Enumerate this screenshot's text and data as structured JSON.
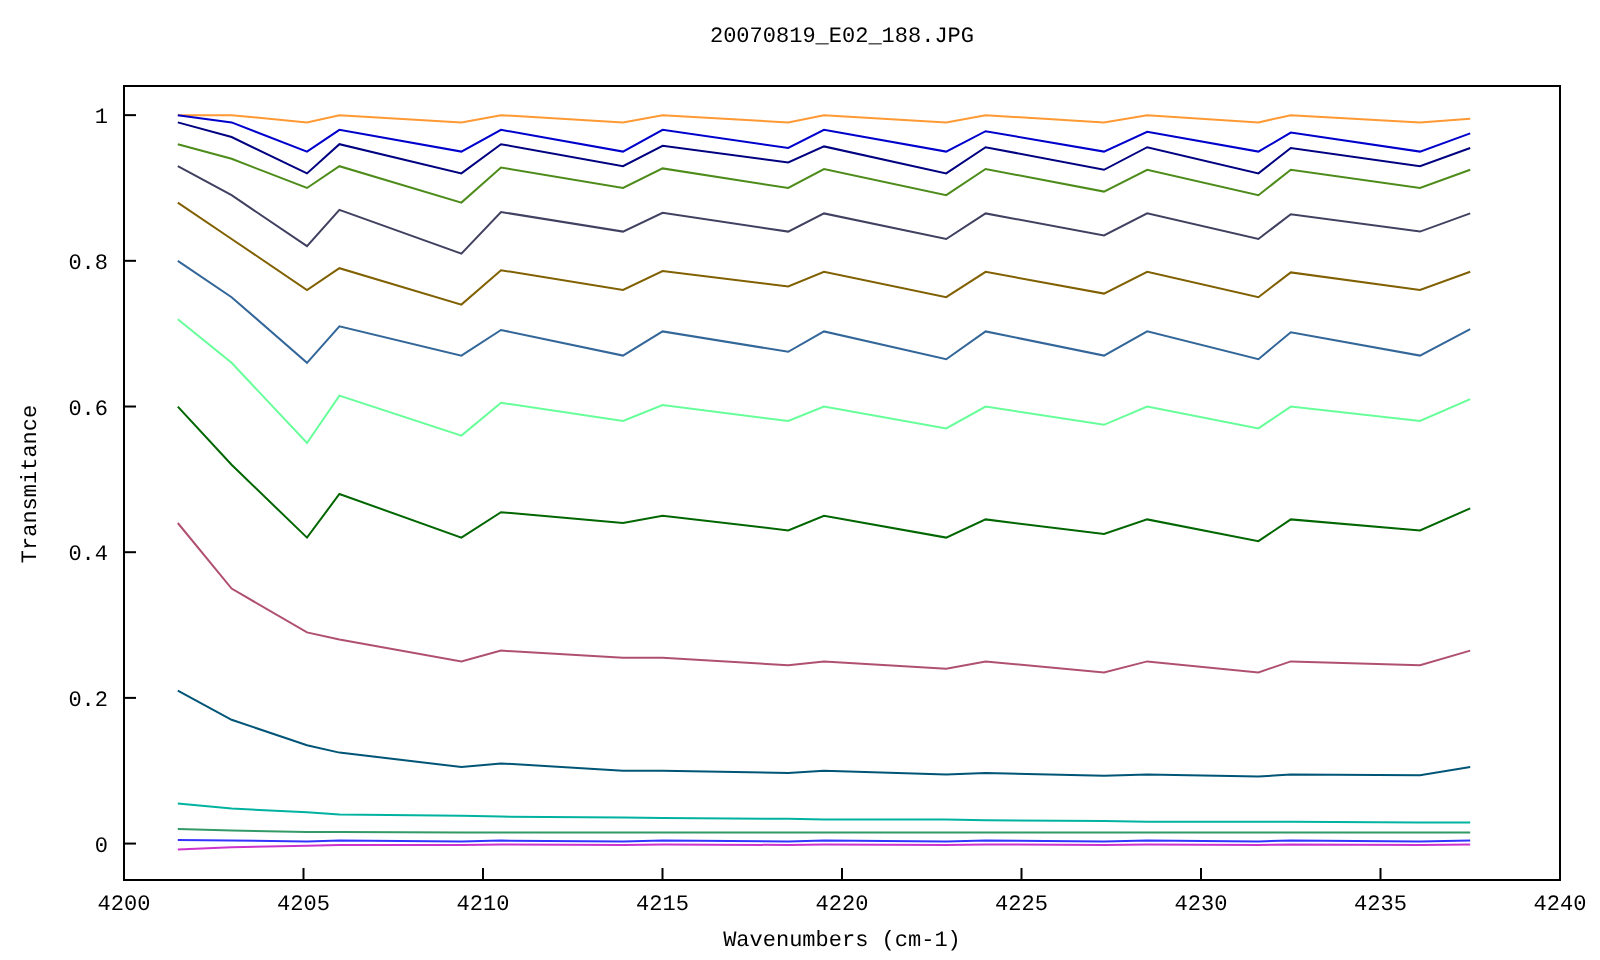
{
  "chart_data": {
    "type": "line",
    "title": "20070819_E02_188.JPG",
    "xlabel": "Wavenumbers (cm-1)",
    "ylabel": "Transmitance",
    "x": [
      4201.5,
      4203,
      4205.1,
      4206,
      4209.4,
      4210.5,
      4213.9,
      4215,
      4218.5,
      4219.5,
      4222.9,
      4224,
      4227.3,
      4228.5,
      4231.6,
      4232.5,
      4236.1,
      4237.5
    ],
    "series": [
      {
        "color": "#ff9933",
        "values": [
          1.0,
          1.0,
          0.99,
          1.0,
          0.99,
          1.0,
          0.99,
          1.0,
          0.99,
          1.0,
          0.99,
          1.0,
          0.99,
          1.0,
          0.99,
          1.0,
          0.99,
          0.995
        ]
      },
      {
        "color": "#0000cc",
        "values": [
          1.0,
          0.99,
          0.95,
          0.98,
          0.95,
          0.98,
          0.95,
          0.98,
          0.955,
          0.98,
          0.95,
          0.978,
          0.95,
          0.977,
          0.95,
          0.976,
          0.95,
          0.975
        ]
      },
      {
        "color": "#000080",
        "values": [
          0.99,
          0.97,
          0.92,
          0.96,
          0.92,
          0.96,
          0.93,
          0.958,
          0.935,
          0.957,
          0.92,
          0.956,
          0.925,
          0.956,
          0.92,
          0.955,
          0.93,
          0.955
        ]
      },
      {
        "color": "#4d8c1a",
        "values": [
          0.96,
          0.94,
          0.9,
          0.93,
          0.88,
          0.928,
          0.9,
          0.927,
          0.9,
          0.926,
          0.89,
          0.926,
          0.895,
          0.925,
          0.89,
          0.925,
          0.9,
          0.925
        ]
      },
      {
        "color": "#404060",
        "values": [
          0.93,
          0.89,
          0.82,
          0.87,
          0.81,
          0.867,
          0.84,
          0.866,
          0.84,
          0.865,
          0.83,
          0.865,
          0.835,
          0.865,
          0.83,
          0.864,
          0.84,
          0.865
        ]
      },
      {
        "color": "#806000",
        "values": [
          0.88,
          0.83,
          0.76,
          0.79,
          0.74,
          0.787,
          0.76,
          0.786,
          0.765,
          0.785,
          0.75,
          0.785,
          0.755,
          0.785,
          0.75,
          0.784,
          0.76,
          0.785
        ]
      },
      {
        "color": "#336699",
        "values": [
          0.8,
          0.75,
          0.66,
          0.71,
          0.67,
          0.705,
          0.67,
          0.703,
          0.675,
          0.703,
          0.665,
          0.703,
          0.67,
          0.703,
          0.665,
          0.702,
          0.67,
          0.706
        ]
      },
      {
        "color": "#66ff99",
        "values": [
          0.72,
          0.66,
          0.55,
          0.615,
          0.56,
          0.605,
          0.58,
          0.602,
          0.58,
          0.6,
          0.57,
          0.6,
          0.575,
          0.6,
          0.57,
          0.6,
          0.58,
          0.61
        ]
      },
      {
        "color": "#006600",
        "values": [
          0.6,
          0.52,
          0.42,
          0.48,
          0.42,
          0.455,
          0.44,
          0.45,
          0.43,
          0.45,
          0.42,
          0.445,
          0.425,
          0.445,
          0.415,
          0.445,
          0.43,
          0.46
        ]
      },
      {
        "color": "#b05070",
        "values": [
          0.44,
          0.35,
          0.29,
          0.28,
          0.25,
          0.265,
          0.255,
          0.255,
          0.245,
          0.25,
          0.24,
          0.25,
          0.235,
          0.25,
          0.235,
          0.25,
          0.245,
          0.265
        ]
      },
      {
        "color": "#005577",
        "values": [
          0.21,
          0.17,
          0.135,
          0.125,
          0.105,
          0.11,
          0.1,
          0.1,
          0.097,
          0.1,
          0.095,
          0.097,
          0.093,
          0.095,
          0.092,
          0.095,
          0.094,
          0.105
        ]
      },
      {
        "color": "#00b3a0",
        "values": [
          0.055,
          0.048,
          0.043,
          0.04,
          0.038,
          0.037,
          0.036,
          0.035,
          0.034,
          0.033,
          0.033,
          0.032,
          0.031,
          0.03,
          0.03,
          0.03,
          0.029,
          0.029
        ]
      },
      {
        "color": "#339966",
        "values": [
          0.02,
          0.018,
          0.016,
          0.016,
          0.015,
          0.015,
          0.015,
          0.015,
          0.015,
          0.015,
          0.015,
          0.015,
          0.015,
          0.015,
          0.015,
          0.015,
          0.015,
          0.015
        ]
      },
      {
        "color": "#3333ff",
        "values": [
          0.005,
          0.004,
          0.003,
          0.004,
          0.003,
          0.004,
          0.003,
          0.004,
          0.003,
          0.004,
          0.003,
          0.004,
          0.003,
          0.004,
          0.003,
          0.004,
          0.003,
          0.004
        ]
      },
      {
        "color": "#cc33cc",
        "values": [
          -0.008,
          -0.005,
          -0.003,
          -0.002,
          -0.002,
          -0.001,
          -0.002,
          -0.001,
          -0.002,
          -0.001,
          -0.002,
          -0.001,
          -0.002,
          -0.001,
          -0.002,
          -0.001,
          -0.002,
          -0.001
        ]
      }
    ],
    "xlim": [
      4200,
      4240
    ],
    "ylim": [
      -0.05,
      1.04
    ],
    "xticks": [
      4200,
      4205,
      4210,
      4215,
      4220,
      4225,
      4230,
      4235,
      4240
    ],
    "yticks": [
      0,
      {
        "value": 0.2,
        "label": "0.2"
      },
      {
        "value": 0.4,
        "label": "0.4"
      },
      {
        "value": 0.6,
        "label": "0.6"
      },
      {
        "value": 0.8,
        "label": "0.8"
      },
      1
    ]
  }
}
